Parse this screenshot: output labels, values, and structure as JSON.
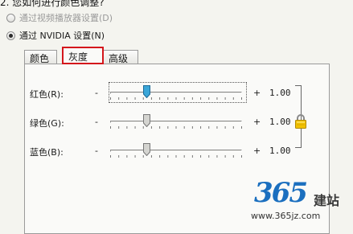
{
  "header": {
    "text": "2. 您如何进行颜色调整?"
  },
  "options": [
    {
      "label": "通过视频播放器设置(D)",
      "checked": false,
      "disabled": true
    },
    {
      "label": "通过 NVIDIA 设置(N)",
      "checked": true,
      "disabled": false
    }
  ],
  "tabs": [
    {
      "label": "颜色",
      "active": false
    },
    {
      "label": "灰度",
      "active": true
    },
    {
      "label": "高级",
      "active": false
    }
  ],
  "sliders": [
    {
      "label": "红色(R):",
      "minus": "-",
      "plus": "+",
      "value": "1.00",
      "position": 0.28,
      "focused": true,
      "thumb_color": "#3aa6d8"
    },
    {
      "label": "绿色(G):",
      "minus": "-",
      "plus": "+",
      "value": "1.00",
      "position": 0.28,
      "focused": false,
      "thumb_color": "#d4d4d0"
    },
    {
      "label": "蓝色(B):",
      "minus": "-",
      "plus": "+",
      "value": "1.00",
      "position": 0.28,
      "focused": false,
      "thumb_color": "#d4d4d0"
    }
  ],
  "lock": {
    "icon": "lock-icon",
    "linked": true
  },
  "watermark": {
    "number": "365",
    "brand": "建站",
    "url": "www.365jz.com"
  },
  "colors": {
    "active_tab_border": "#d4161c",
    "watermark_blue": "#1b6fbf",
    "panel_bg": "#fafaf8"
  }
}
